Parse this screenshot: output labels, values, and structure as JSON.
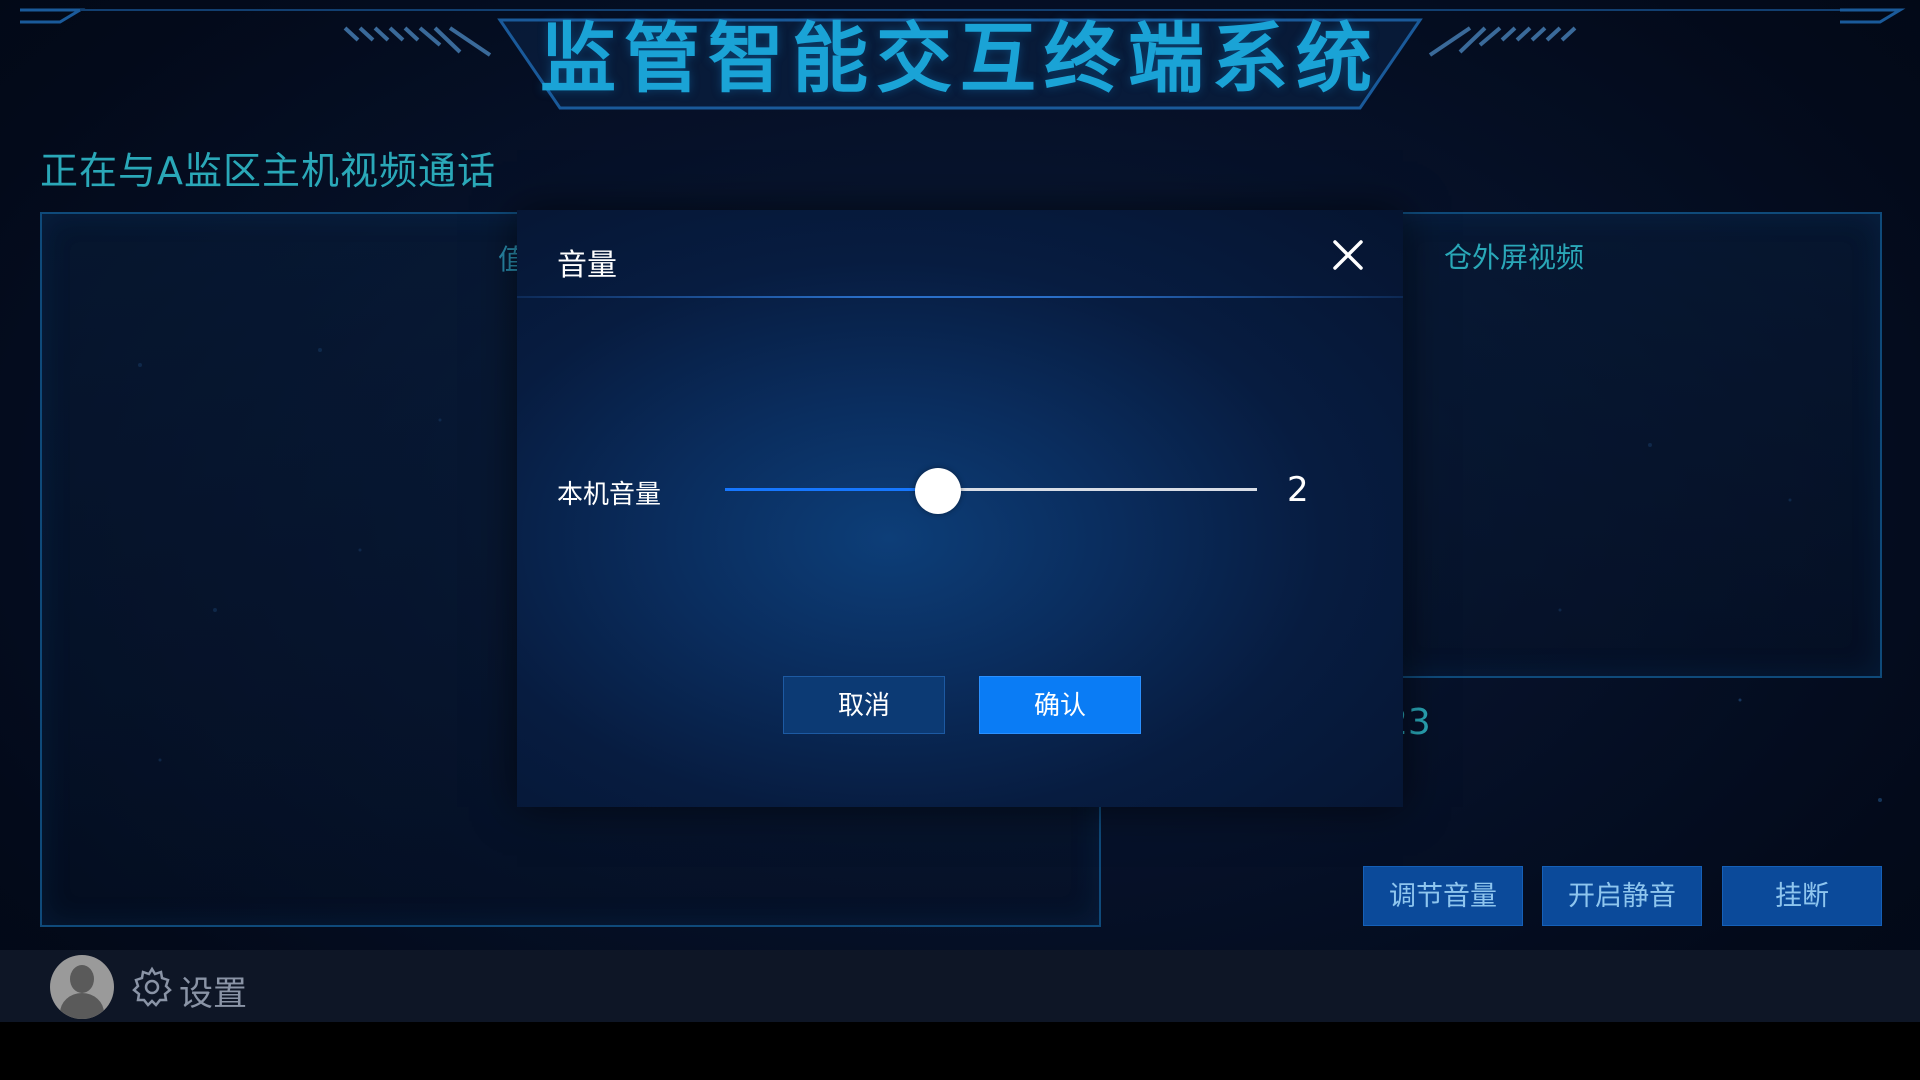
{
  "app": {
    "title": "监管智能交互终端系统"
  },
  "call": {
    "status": "正在与A监区主机视频通话",
    "left_panel_label": "值",
    "right_panel_label": "仓外屏视频",
    "timer_partial": "23"
  },
  "actions": {
    "adjust_volume": "调节音量",
    "mute": "开启静音",
    "hangup": "挂断"
  },
  "footer": {
    "settings_label": "设置",
    "avatar_icon": "user-avatar-icon",
    "settings_icon": "gear-icon"
  },
  "volume_dialog": {
    "title": "音量",
    "close_icon": "close-icon",
    "slider_label": "本机音量",
    "value": 2,
    "value_text": "2",
    "max": 5,
    "cancel_label": "取消",
    "confirm_label": "确认"
  },
  "colors": {
    "title": "#1aa3d6",
    "accent_text": "#2aa8b8",
    "button_bg": "#0b4a9a",
    "confirm_bg": "#0a7cf5",
    "slider_fill": "#1677ff"
  }
}
